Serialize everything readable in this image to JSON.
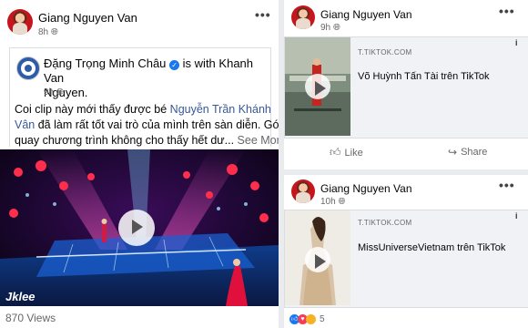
{
  "left_post": {
    "author": "Giang Nguyen Van",
    "time": "8h",
    "more_icon": "more-dots-icon",
    "shared": {
      "author": "Đặng Trọng Minh Châu",
      "with_text": "is with",
      "tagged_first": "Khanh Van",
      "tagged_second": "Nguyen.",
      "time": "9h",
      "body_line1": "Coi clip này mới thấy được bé",
      "mention_part1": "Nguyễn Trần Khánh",
      "mention_part2": "Vân",
      "body_line2_rest": "đã làm rất tốt vai trò của mình trên sàn diễn. Góc",
      "body_line3": "quay chương trình không cho thấy hết dư...",
      "see_more": "See More"
    },
    "video_watermark": "Jklee",
    "views": "870 Views"
  },
  "right_posts": [
    {
      "author": "Giang Nguyen Van",
      "time": "9h",
      "link_domain": "T.TIKTOK.COM",
      "link_title": "Võ Huỳnh Tấn Tài trên TikTok",
      "like_label": "Like",
      "share_label": "Share"
    },
    {
      "author": "Giang Nguyen Van",
      "time": "10h",
      "link_domain": "T.TIKTOK.COM",
      "link_title": "MissUniverseVietnam trên TikTok",
      "reaction_count": "5"
    }
  ],
  "colors": {
    "link_blue": "#385898",
    "verified_blue": "#1877f2",
    "like_blue": "#1877f2",
    "love_red": "#f33e58"
  }
}
